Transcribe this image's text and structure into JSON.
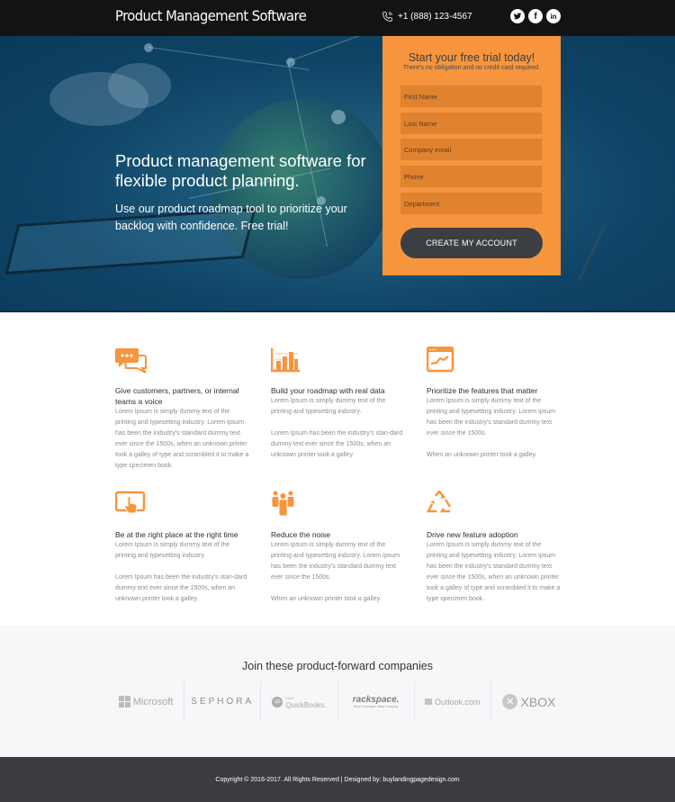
{
  "header": {
    "brand": "Product Management Software",
    "phone": "+1 (888) 123-4567",
    "social": [
      {
        "name": "twitter",
        "glyph": "t"
      },
      {
        "name": "facebook",
        "glyph": "f"
      },
      {
        "name": "linkedin",
        "glyph": "in"
      }
    ]
  },
  "hero": {
    "title": "Product management software for flexible product planning.",
    "subtitle": "Use our product roadmap tool to prioritize your backlog with confidence. Free trial!"
  },
  "form": {
    "title": "Start your free trial today!",
    "note": "There's no obligation and no credit card required.",
    "fields": [
      {
        "placeholder": "First Name",
        "value": ""
      },
      {
        "placeholder": "Last Name",
        "value": ""
      },
      {
        "placeholder": "Company email",
        "value": ""
      },
      {
        "placeholder": "Phone",
        "value": ""
      },
      {
        "placeholder": "Department",
        "value": ""
      }
    ],
    "submit_label": "CREATE MY ACCOUNT"
  },
  "features": [
    {
      "icon": "chat-bubbles-icon",
      "title": "Give customers, partners, or internal teams a voice",
      "body": "Lorem Ipsum is simply dummy text of the printing and typesetting industry. Lorem Ipsum has been the industry's standard dummy text ever since the 1500s, when an unknown printer took a galley of type and scrambled it to make a type specimen book."
    },
    {
      "icon": "bar-chart-icon",
      "title": "Build your roadmap with real data",
      "body": "Lorem Ipsum is simply dummy text of the printing and typesetting industry.\n\nLorem Ipsum has been the industry's stan-dard dummy text ever since the 1500s, when an unknown printer took a galley."
    },
    {
      "icon": "browser-chart-icon",
      "title": "Prioritize the features that matter",
      "body": "Lorem Ipsum is simply dummy text of the printing and typesetting industry. Lorem Ipsum has been the industry's standard dummy text ever since the 1500s.\n\nWhen an unknown printer took a galley."
    },
    {
      "icon": "tablet-touch-icon",
      "title": "Be at the right place at the right time",
      "body": "Lorem Ipsum is simply dummy text of the printing and typesetting industry.\n\nLorem Ipsum has been the industry's stan-dard dummy text ever since the 1500s, when an unknown printer took a galley."
    },
    {
      "icon": "people-group-icon",
      "title": "Reduce the noise",
      "body": "Lorem Ipsum is simply dummy text of the printing and typesetting industry. Lorem Ipsum has been the industry's standard dummy text ever since the 1500s.\n\nWhen an unknown printer took a galley."
    },
    {
      "icon": "recycle-arrows-icon",
      "title": "Drive new feature adoption",
      "body": "Lorem Ipsum is simply dummy text of the printing and typesetting industry. Lorem Ipsum has been the industry's standard dummy text ever since the 1500s, when an unknown printer took a galley of type and scrambled it to make a type specimen book."
    }
  ],
  "companies": {
    "title": "Join these product-forward companies",
    "logos": [
      "Microsoft",
      "SEPHORA",
      "QuickBooks.",
      "rackspace.",
      "Outlook.com",
      "XBOX"
    ],
    "quickbooks_tag": "intuit",
    "rackspace_tag": "the #1 managed cloud company"
  },
  "footer": {
    "text": "Copyright © 2016-2017. All Rights Reserved | Designed by: buylandingpagedesign.com"
  },
  "colors": {
    "accent": "#f7953e",
    "field": "#e0822e",
    "dark": "#3b3e43",
    "topbar": "#131313",
    "hero": "#0f4466"
  }
}
